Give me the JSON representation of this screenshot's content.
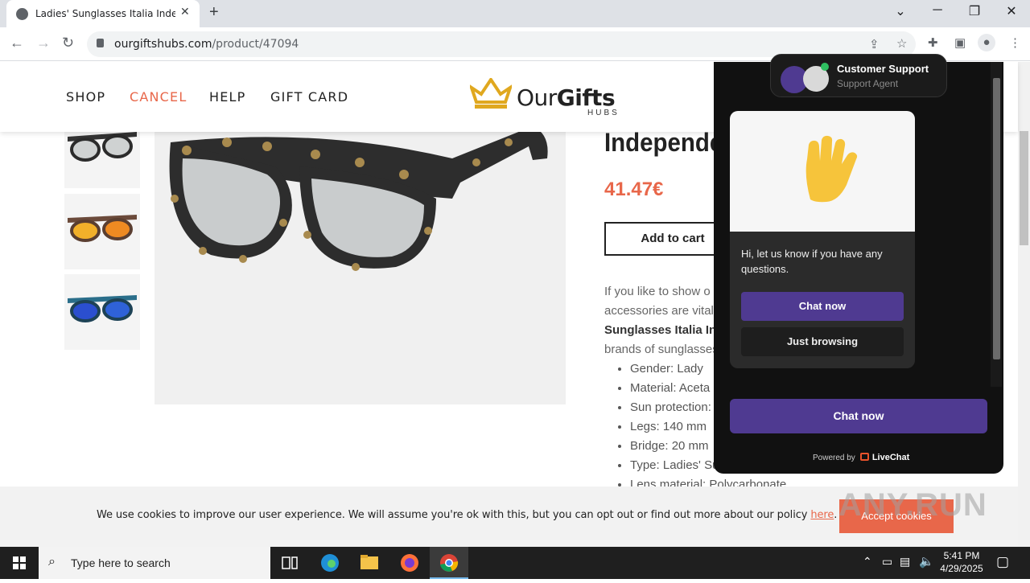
{
  "browser": {
    "tab_title": "Ladies' Sunglasses Italia Indepen",
    "url_domain": "ourgiftshubs.com",
    "url_path": "/product/47094"
  },
  "site": {
    "nav": [
      "SHOP",
      "CANCEL",
      "HELP",
      "GIFT CARD"
    ],
    "active_nav": "CANCEL",
    "logo_prefix": "Our",
    "logo_bold": "Gifts",
    "logo_sub": "HUBS"
  },
  "product": {
    "title": "Independe",
    "price": "41.47€",
    "add_to_cart": "Add to cart",
    "desc_lines": [
      "If you like to show o",
      "accessories are vital",
      "Sunglasses Italia Ind",
      "brands of sunglasses"
    ],
    "specs": [
      "Gender: Lady",
      "Material: Aceta",
      "Sun protection:",
      "Legs: 140 mm",
      "Bridge: 20 mm",
      "Type: Ladies' Su",
      "Lens material: Polycarbonate"
    ]
  },
  "chat": {
    "agent_name": "Customer Support",
    "agent_role": "Support Agent",
    "message": "Hi, let us know if you have any questions.",
    "chat_now": "Chat now",
    "just_browsing": "Just browsing",
    "chat_now_bottom": "Chat now",
    "powered_by": "Powered by",
    "brand": "LiveChat"
  },
  "cookie": {
    "text": "We use cookies to improve our user experience. We will assume you're ok with this, but you can opt out or find out more about our policy ",
    "link": "here",
    "after_link": ".",
    "accept": "Accept cookies"
  },
  "watermark": "ANY.RUN",
  "taskbar": {
    "search_placeholder": "Type here to search",
    "time": "5:41 PM",
    "date": "4/29/2025"
  },
  "colors": {
    "accent": "#e8674a",
    "chat_purple": "#4f3a91",
    "chat_bg": "#111111"
  }
}
